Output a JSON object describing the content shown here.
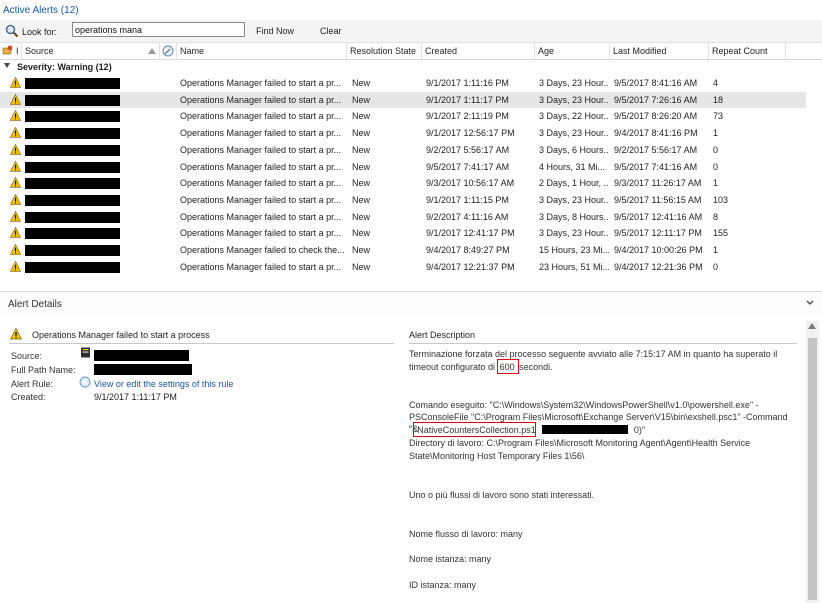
{
  "window": {
    "title": "Active Alerts (12)"
  },
  "search": {
    "label": "Look for:",
    "value": "operations mana",
    "find_now": "Find Now",
    "clear": "Clear"
  },
  "columns": [
    "I",
    "Source",
    "Name",
    "Resolution State",
    "Created",
    "Age",
    "Last Modified",
    "Repeat Count"
  ],
  "group": {
    "label": "Severity: Warning (12)"
  },
  "alerts": [
    {
      "name": "Operations Manager failed to start a pr...",
      "state": "New",
      "created": "9/1/2017 1:11:16 PM",
      "age": "3 Days, 23 Hour...",
      "modified": "9/5/2017 8:41:16 AM",
      "count": "4"
    },
    {
      "name": "Operations Manager failed to start a pr...",
      "state": "New",
      "created": "9/1/2017 1:11:17 PM",
      "age": "3 Days, 23 Hour...",
      "modified": "9/5/2017 7:26:16 AM",
      "count": "18"
    },
    {
      "name": "Operations Manager failed to start a pr...",
      "state": "New",
      "created": "9/1/2017 2:11:19 PM",
      "age": "3 Days, 22 Hour...",
      "modified": "9/5/2017 8:26:20 AM",
      "count": "73"
    },
    {
      "name": "Operations Manager failed to start a pr...",
      "state": "New",
      "created": "9/1/2017 12:56:17 PM",
      "age": "3 Days, 23 Hour...",
      "modified": "9/4/2017 8:41:16 PM",
      "count": "1"
    },
    {
      "name": "Operations Manager failed to start a pr...",
      "state": "New",
      "created": "9/2/2017 5:56:17 AM",
      "age": "3 Days, 6 Hours...",
      "modified": "9/2/2017 5:56:17 AM",
      "count": "0"
    },
    {
      "name": "Operations Manager failed to start a pr...",
      "state": "New",
      "created": "9/5/2017 7:41:17 AM",
      "age": "4 Hours, 31 Mi...",
      "modified": "9/5/2017 7:41:16 AM",
      "count": "0"
    },
    {
      "name": "Operations Manager failed to start a pr...",
      "state": "New",
      "created": "9/3/2017 10:56:17 AM",
      "age": "2 Days, 1 Hour, ...",
      "modified": "9/3/2017 11:26:17 AM",
      "count": "1"
    },
    {
      "name": "Operations Manager failed to start a pr...",
      "state": "New",
      "created": "9/1/2017 1:11:15 PM",
      "age": "3 Days, 23 Hour...",
      "modified": "9/5/2017 11:56:15 AM",
      "count": "103"
    },
    {
      "name": "Operations Manager failed to start a pr...",
      "state": "New",
      "created": "9/2/2017 4:11:16 AM",
      "age": "3 Days, 8 Hours...",
      "modified": "9/5/2017 12:41:16 AM",
      "count": "8"
    },
    {
      "name": "Operations Manager failed to start a pr...",
      "state": "New",
      "created": "9/1/2017 12:41:17 PM",
      "age": "3 Days, 23 Hour...",
      "modified": "9/5/2017 12:11:17 PM",
      "count": "155"
    },
    {
      "name": "Operations Manager failed to check the...",
      "state": "New",
      "created": "9/4/2017 8:49:27 PM",
      "age": "15 Hours, 23 Mi...",
      "modified": "9/4/2017 10:00:26 PM",
      "count": "1"
    },
    {
      "name": "Operations Manager failed to start a pr...",
      "state": "New",
      "created": "9/4/2017 12:21:37 PM",
      "age": "23 Hours, 51 Mi...",
      "modified": "9/4/2017 12:21:36 PM",
      "count": "0"
    }
  ],
  "details": {
    "title": "Alert Details",
    "alert_name": "Operations Manager failed to start a process",
    "labels": {
      "source": "Source:",
      "full_path": "Full Path Name:",
      "rule": "Alert Rule:",
      "created": "Created:"
    },
    "rule_link": "View or edit the settings of this rule",
    "created": "9/1/2017 1:11:17 PM",
    "description_title": "Alert Description",
    "desc_line1": "Terminazione forzata del processo seguente avviato alle 7:15:17 AM in quanto ha superato il",
    "desc_line2a": "timeout configurato di",
    "timeout_value": "600",
    "desc_line2b": "secondi.",
    "cmd_line1": "Comando eseguito: \"C:\\Windows\\System32\\WindowsPowerShell\\v1.0\\powershell.exe\" -",
    "cmd_line2": "PSConsoleFile \"C:\\Program Files\\Microsoft\\Exchange Server\\V15\\bin\\exshell.psc1\" -Command \"&",
    "cmd_line3a": "'",
    "script_name": "NativeCountersCollection.ps1",
    "cmd_line3b": "0)\"",
    "workdir_line1": "Directory di lavoro: C:\\Program Files\\Microsoft Monitoring Agent\\Agent\\Health Service",
    "workdir_line2": "State\\Monitoring Host Temporary Files 1\\56\\",
    "workflows": "Uno o più flussi di lavoro sono stati interessati.",
    "workflow_name": "Nome flusso di lavoro: many",
    "instance_name": "Nome istanza: many",
    "instance_id": "ID istanza: many"
  },
  "colors": {
    "title_blue": "#1a57a8",
    "link_blue": "#1a57a8",
    "warning_yellow": "#f2c200",
    "highlight_red": "#e0001b",
    "selected_row": "#e6e6e6"
  }
}
